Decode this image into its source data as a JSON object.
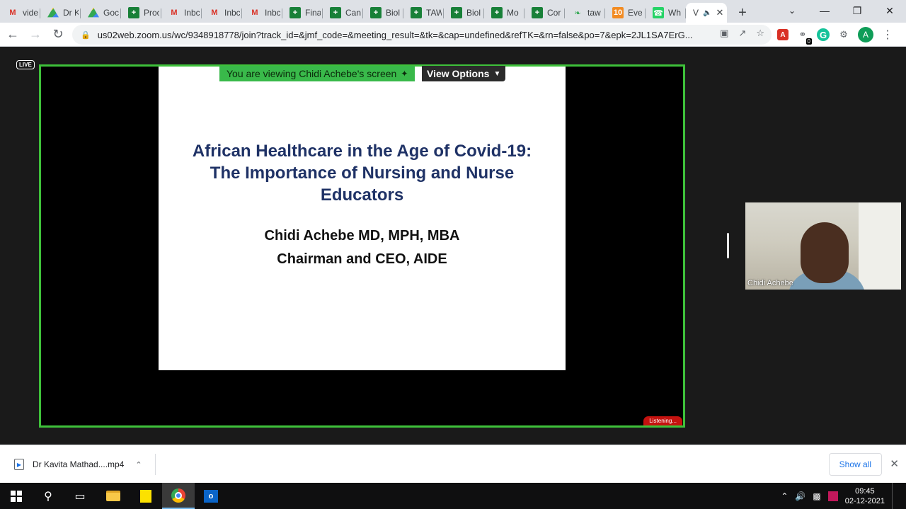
{
  "browser": {
    "tabs": [
      {
        "icon": "gmail-icon",
        "title": "vide"
      },
      {
        "icon": "google-drive-icon",
        "title": "Dr K"
      },
      {
        "icon": "google-drive-icon",
        "title": "Goc"
      },
      {
        "icon": "google-sheets-icon",
        "title": "Proc"
      },
      {
        "icon": "gmail-icon",
        "title": "Inbc"
      },
      {
        "icon": "gmail-icon",
        "title": "Inbc"
      },
      {
        "icon": "gmail-icon",
        "title": "Inbc"
      },
      {
        "icon": "google-sheets-icon",
        "title": "Fina"
      },
      {
        "icon": "google-sheets-icon",
        "title": "Can"
      },
      {
        "icon": "google-sheets-icon",
        "title": "Biol"
      },
      {
        "icon": "google-sheets-icon",
        "title": "TAW"
      },
      {
        "icon": "google-sheets-icon",
        "title": "Biol"
      },
      {
        "icon": "google-sheets-icon",
        "title": "Mo"
      },
      {
        "icon": "google-sheets-icon",
        "title": "Cor"
      },
      {
        "icon": "leaf-icon",
        "title": "taw"
      },
      {
        "icon": "tenten-icon",
        "title": "Eve"
      },
      {
        "icon": "whatsapp-icon",
        "title": "Wh"
      }
    ],
    "active_tab": {
      "title": "V",
      "audio_icon": "speaker-icon"
    },
    "url": "us02web.zoom.us/wc/9348918778/join?track_id=&jmf_code=&meeting_result=&tk=&cap=undefined&refTK=&rn=false&po=7&epk=2JL1SA7ErG...",
    "profile_initial": "A",
    "extension_badge": "0"
  },
  "meeting": {
    "live_label": "LIVE",
    "viewing_banner": "You are viewing Chidi Achebe's screen",
    "view_options_label": "View Options",
    "listening_label": "Listening...",
    "participant_name": "Chidi Achebe",
    "slide": {
      "title": "African Healthcare in the Age of Covid-19: The Importance of Nursing and Nurse Educators",
      "author": "Chidi Achebe MD, MPH, MBA",
      "role": "Chairman and CEO, AIDE"
    }
  },
  "downloads": {
    "file_name": "Dr Kavita Mathad....mp4",
    "show_all_label": "Show all"
  },
  "taskbar": {
    "time": "09:45",
    "date": "02-12-2021"
  }
}
